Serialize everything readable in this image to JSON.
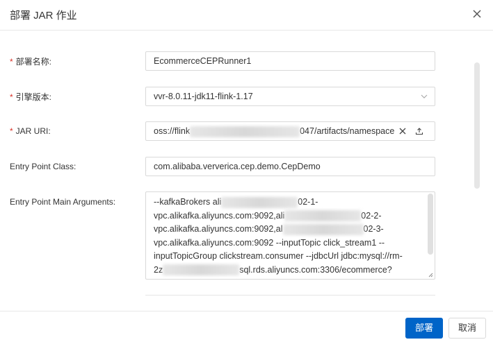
{
  "dialog": {
    "title": "部署 JAR 作业"
  },
  "form": {
    "deployment_name": {
      "required_mark": "*",
      "label": "部署名称:",
      "value": "EcommerceCEPRunner1"
    },
    "engine_version": {
      "required_mark": "*",
      "label": "引擎版本:",
      "value": "vvr-8.0.11-jdk11-flink-1.17"
    },
    "jar_uri": {
      "required_mark": "*",
      "label": "JAR URI:",
      "value_prefix": "oss://flink",
      "value_suffix": "047/artifacts/namespace"
    },
    "entry_point_class": {
      "label": "Entry Point Class:",
      "value": "com.alibaba.ververica.cep.demo.CepDemo"
    },
    "entry_point_args": {
      "label": "Entry Point Main Arguments:",
      "line1_a": "--kafkaBrokers ali",
      "line1_b": "02-1-",
      "line2_a": "vpc.alikafka.aliyuncs.com:9092,ali",
      "line2_b": "02-2-",
      "line3_a": "vpc.alikafka.aliyuncs.com:9092,al",
      "line3_b": "02-3-",
      "line4": "vpc.alikafka.aliyuncs.com:9092 --inputTopic click_stream1 --",
      "line5": "inputTopicGroup clickstream.consumer --jdbcUrl jdbc:mysql://rm-",
      "line6_a": "2z",
      "line6_b": "sql.rds.aliyuncs.com:3306/ecommerce?"
    }
  },
  "footer": {
    "deploy_label": "部署",
    "cancel_label": "取消"
  },
  "colors": {
    "primary": "#0064c8",
    "required": "#d93026",
    "border": "#d9d9d9"
  },
  "icons": [
    "close-icon",
    "chevron-down-icon",
    "clear-icon",
    "upload-icon",
    "resize-grip-icon"
  ]
}
